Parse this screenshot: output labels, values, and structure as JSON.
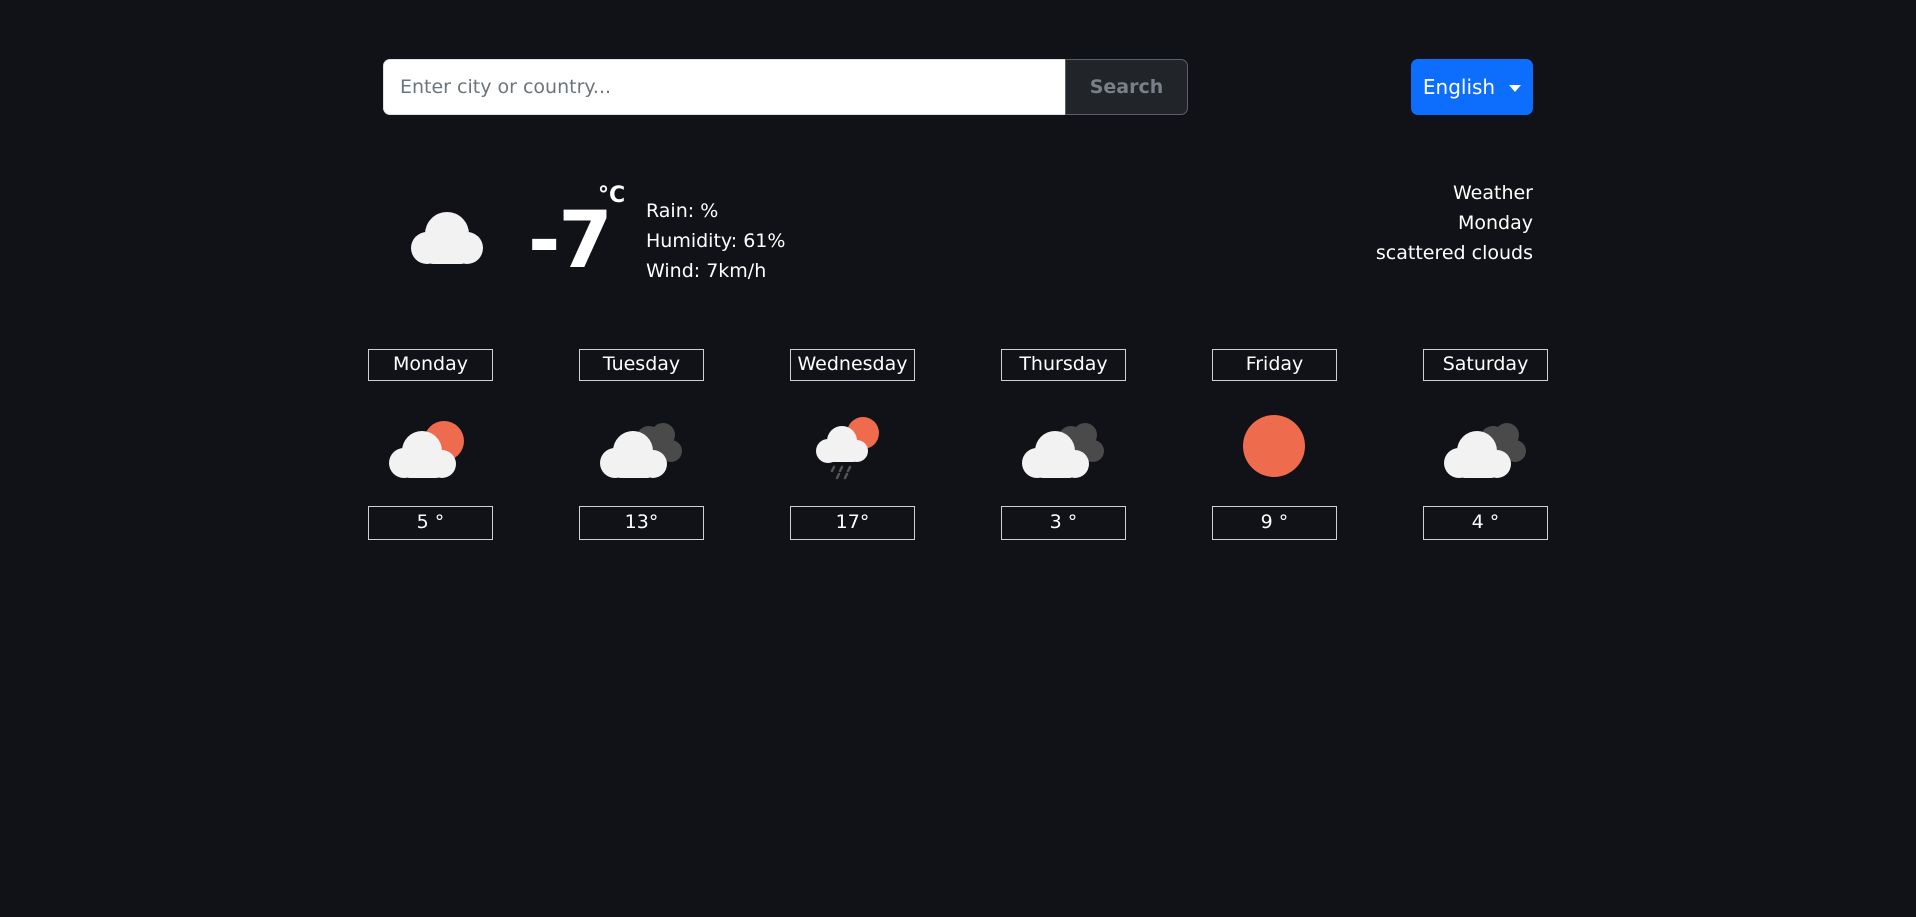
{
  "search": {
    "placeholder": "Enter city or country...",
    "value": "",
    "button_label": "Search"
  },
  "language": {
    "selected": "English"
  },
  "current": {
    "icon": "cloud-icon",
    "temperature": "-7",
    "unit": "°C",
    "rain": "Rain: %",
    "humidity": "Humidity: 61%",
    "wind": "Wind: 7km/h",
    "summary_title": "Weather",
    "summary_day": "Monday",
    "summary_description": "scattered clouds"
  },
  "forecast": [
    {
      "day": "Monday",
      "temp": "5 °",
      "icon": "partly-cloudy-sun-icon"
    },
    {
      "day": "Tuesday",
      "temp": "13°",
      "icon": "broken-clouds-icon"
    },
    {
      "day": "Wednesday",
      "temp": "17°",
      "icon": "rain-sun-icon"
    },
    {
      "day": "Thursday",
      "temp": "3 °",
      "icon": "broken-clouds-icon"
    },
    {
      "day": "Friday",
      "temp": "9 °",
      "icon": "sun-icon"
    },
    {
      "day": "Saturday",
      "temp": "4 °",
      "icon": "broken-clouds-icon"
    }
  ],
  "colors": {
    "background": "#111217",
    "accent": "#0d6efd",
    "sun": "#ee6c4d",
    "cloud": "#f2f2f2",
    "dark_cloud": "#4a4a4a"
  }
}
